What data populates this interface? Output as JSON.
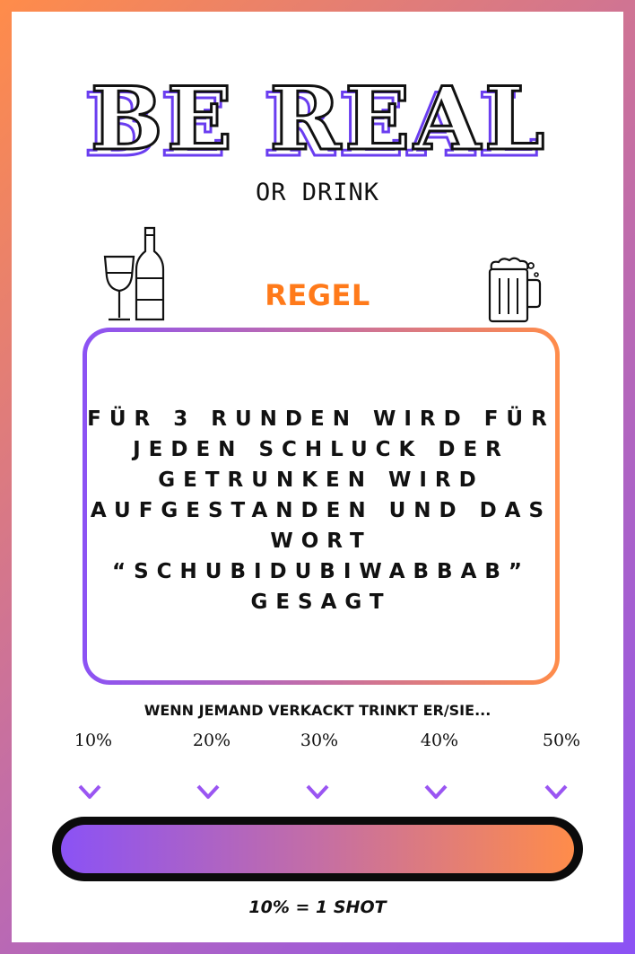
{
  "title": "BE REAL",
  "subtitle": "OR DRINK",
  "regel_heading": "REGEL",
  "rule_lines": [
    "Für 3 Runden wird für",
    "jeden Schluck der",
    "getrunken wird",
    "aufgestanden und das",
    "Wort",
    "“Schubidubiwabbab”",
    "gesagt"
  ],
  "question": "WENN JEMAND VERKACKT TRINKT ER/SIE...",
  "percentages": [
    "10%",
    "20%",
    "30%",
    "40%",
    "50%"
  ],
  "progress_fill": 1.0,
  "footer": "10% = 1 SHOT",
  "icons": [
    "wine-glass-icon",
    "wine-bottle-icon",
    "beer-mug-icon",
    "arrow-down-icon"
  ],
  "colors": {
    "orange": "#ff8c4a",
    "regel_orange": "#ff7a1a",
    "purple": "#8b52f5",
    "title_shadow": "#6a3df0",
    "text": "#111111"
  }
}
